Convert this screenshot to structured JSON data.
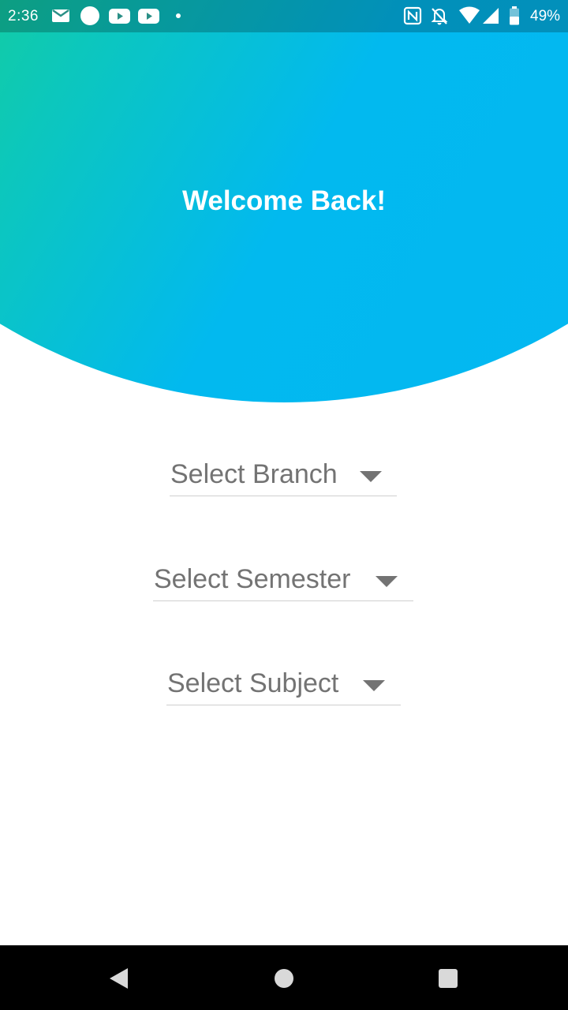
{
  "status_bar": {
    "time": "2:36",
    "battery": "49%",
    "icons": [
      "mail-icon",
      "circle-icon",
      "youtube-icon",
      "youtube-icon",
      "dot-icon",
      "nfc-icon",
      "notifications-off-icon",
      "wifi-icon",
      "cell-signal-icon",
      "battery-icon"
    ]
  },
  "header": {
    "title": "Welcome Back!",
    "gradient_start": "#1fd86b",
    "gradient_end": "#05b7f3"
  },
  "form": {
    "branch_label": "Select Branch",
    "semester_label": "Select Semester",
    "subject_label": "Select Subject"
  },
  "nav_bar": {
    "buttons": [
      "back-icon",
      "home-icon",
      "recents-icon"
    ]
  }
}
